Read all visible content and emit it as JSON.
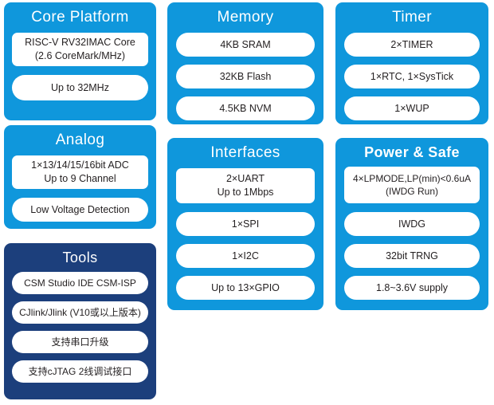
{
  "theme": {
    "accent_blue": "#0f97dc",
    "dark_blue": "#1c3f7c",
    "pill_background": "#ffffff",
    "pill_text": "#231f20",
    "title_text": "#ffffff",
    "page_background": "#ffffff"
  },
  "panels": {
    "core": {
      "title": "Core Platform",
      "items": [
        "RISC-V RV32IMAC Core\n(2.6 CoreMark/MHz)",
        "Up to 32MHz"
      ]
    },
    "analog": {
      "title": "Analog",
      "items": [
        "1×13/14/15/16bit ADC\nUp to 9 Channel",
        "Low Voltage Detection"
      ]
    },
    "tools": {
      "title": "Tools",
      "items": [
        "CSM Studio IDE   CSM-ISP",
        "CJlink/Jlink (V10或以上版本)",
        "支持串口升级",
        "支持cJTAG 2线调试接口"
      ]
    },
    "memory": {
      "title": "Memory",
      "items": [
        "4KB SRAM",
        "32KB Flash",
        "4.5KB NVM"
      ]
    },
    "interfaces": {
      "title": "Interfaces",
      "items": [
        "2×UART\nUp to 1Mbps",
        "1×SPI",
        "1×I2C",
        "Up to 13×GPIO"
      ]
    },
    "timer": {
      "title": "Timer",
      "items": [
        "2×TIMER",
        "1×RTC, 1×SysTick",
        "1×WUP"
      ]
    },
    "power": {
      "title": "Power & Safe",
      "items": [
        "4×LPMODE,LP(min)<0.6uA\n(IWDG Run)",
        "IWDG",
        "32bit TRNG",
        "1.8~3.6V supply"
      ]
    }
  }
}
